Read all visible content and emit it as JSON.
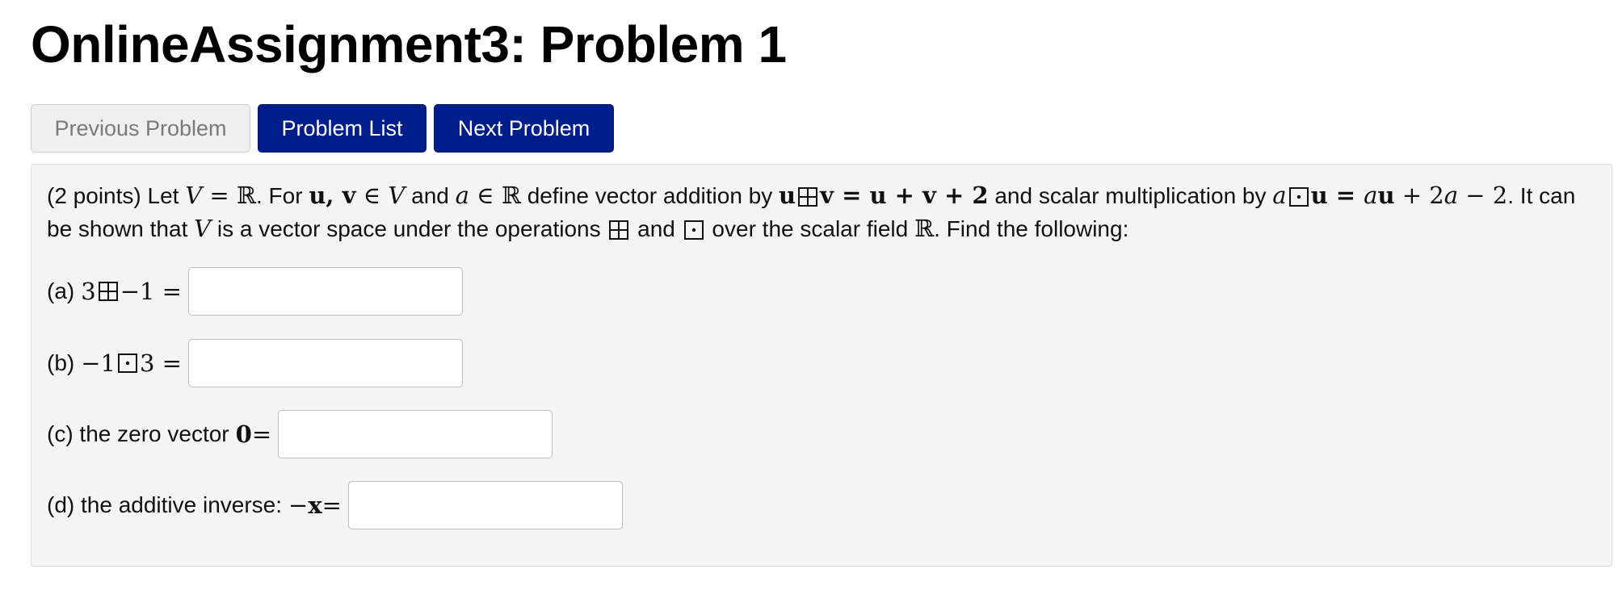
{
  "page": {
    "title": "OnlineAssignment3: Problem 1"
  },
  "nav": {
    "previous_label": "Previous Problem",
    "list_label": "Problem List",
    "next_label": "Next Problem"
  },
  "problem": {
    "points": "(2 points) Let ",
    "t1": ". For ",
    "t2": " and ",
    "t3": " define vector addition by ",
    "t4": " and scalar multiplication by ",
    "t5": ". It can be shown that ",
    "t6": " is a vector space under the operations ",
    "t7": " and ",
    "t8": " over the scalar field ",
    "t9": ". Find the following:",
    "math": {
      "V": "V",
      "eq_R": " = ℝ",
      "uv": "u, v",
      "in_V_sym": " ∈ ",
      "a": "a",
      "in_R": " ∈ ℝ",
      "u": "u",
      "v_eq": "v = u + v + 2",
      "a2": "a",
      "u_eq": "u = ",
      "au_a": "a",
      "au_u": "u",
      "au_rest": " + 2",
      "au_a2": "a",
      "au_end": " − 2",
      "R": "ℝ"
    }
  },
  "parts": [
    {
      "label": "(a)",
      "expr_left": "3",
      "expr_right": "−1 =",
      "operator_icon": "boxplus-icon",
      "value": "",
      "placeholder": ""
    },
    {
      "label": "(b)",
      "expr_left": "−1",
      "expr_right": "3 =",
      "operator_icon": "boxdot-icon",
      "value": "",
      "placeholder": ""
    },
    {
      "label": "(c) the zero vector",
      "zero_symbol": "0",
      "expr_right": " =",
      "value": "",
      "placeholder": ""
    },
    {
      "label": "(d) the additive inverse:",
      "expr_minus": "−",
      "expr_x": "x",
      "expr_right": " =",
      "value": "",
      "placeholder": ""
    }
  ],
  "icons": {
    "boxplus": "boxplus-icon",
    "boxdot": "boxdot-icon"
  },
  "colors": {
    "primary_button": "#001d8c",
    "disabled_button": "#efefef",
    "panel_background": "#f4f4f4"
  }
}
